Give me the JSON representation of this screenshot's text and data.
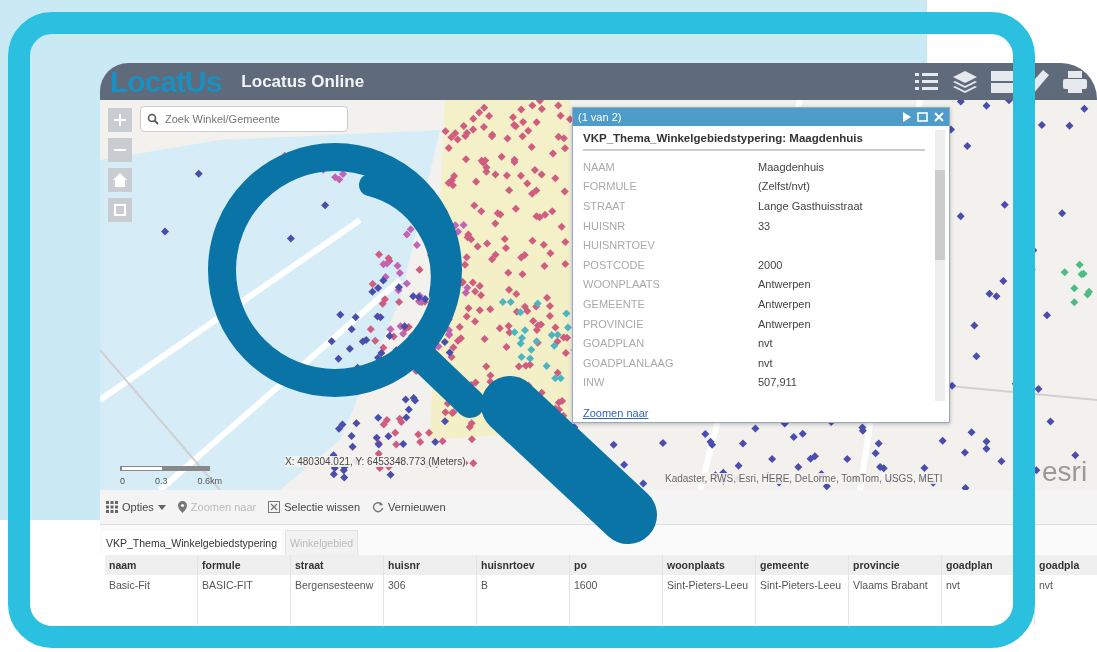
{
  "header": {
    "logo": "LocatUs",
    "title": "Locatus Online"
  },
  "search": {
    "placeholder": "Zoek Winkel/Gemeente"
  },
  "map": {
    "scale_labels": [
      "0",
      "0.3",
      "0.6km"
    ],
    "coordinates": "X: 480304.021, Y: 6453348.773 (Meters)",
    "attribution": "Kadaster, RWS, Esri, HERE, DeLorme, TomTom, USGS, METI",
    "esri": "esri"
  },
  "popup": {
    "counter": "(1 van 2)",
    "heading": "VKP_Thema_Winkelgebiedstypering: Maagdenhuis",
    "link": "Zoomen naar",
    "fields": [
      {
        "label": "NAAM",
        "value": "Maagdenhuis"
      },
      {
        "label": "FORMULE",
        "value": "(Zelfst/nvt)"
      },
      {
        "label": "STRAAT",
        "value": "Lange Gasthuisstraat"
      },
      {
        "label": "HUISNR",
        "value": "33"
      },
      {
        "label": "HUISNRTOEV"
      },
      {
        "label": "POSTCODE",
        "value": "2000"
      },
      {
        "label": "WOONPLAATS",
        "value": "Antwerpen"
      },
      {
        "label": "GEMEENTE",
        "value": "Antwerpen"
      },
      {
        "label": "PROVINCIE",
        "value": "Antwerpen"
      },
      {
        "label": "GOADPLAN",
        "value": "nvt"
      },
      {
        "label": "GOADPLANLAAG",
        "value": "nvt"
      },
      {
        "label": "INW",
        "value": "507,911"
      }
    ]
  },
  "toolbar": [
    {
      "kind": "menu",
      "label": "Opties",
      "disabled": false
    },
    {
      "kind": "pin",
      "label": "Zoomen naar",
      "disabled": true
    },
    {
      "kind": "clear",
      "label": "Selectie wissen",
      "disabled": false
    },
    {
      "kind": "refresh",
      "label": "Vernieuwen",
      "disabled": false
    }
  ],
  "tabs": [
    {
      "label": "VKP_Thema_Winkelgebiedstypering",
      "selected": true
    },
    {
      "label": "Winkelgebied",
      "selected": false
    }
  ],
  "table": {
    "columns": [
      "naam",
      "formule",
      "straat",
      "huisnr",
      "huisnrtoev",
      "po",
      "woonplaats",
      "gemeente",
      "provincie",
      "goadplan",
      "goadpla"
    ],
    "rows": [
      [
        "Basic-Fit",
        "BASIC-FIT",
        "Bergensesteenw",
        "306",
        "B",
        "1600",
        "Sint-Pieters-Leeu",
        "Sint-Pieters-Leeu",
        "Vlaams Brabant",
        "nvt",
        "nvt"
      ]
    ]
  }
}
